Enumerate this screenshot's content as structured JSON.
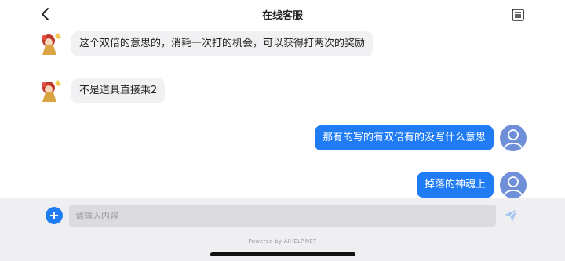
{
  "header": {
    "title": "在线客服",
    "back_icon": "chevron-left-icon",
    "menu_icon": "document-list-icon"
  },
  "messages": [
    {
      "from": "agent",
      "text": "这个双倍的意思的，消耗一次打的机会，可以获得打两次的奖励"
    },
    {
      "from": "agent",
      "text": "不是道具直接乘2"
    },
    {
      "from": "user",
      "text": "那有的写的有双倍有的没写什么意思"
    },
    {
      "from": "user",
      "text": "掉落的神魂上"
    }
  ],
  "composer": {
    "placeholder": "请输入内容",
    "add_icon": "plus-circle-icon",
    "send_icon": "send-icon",
    "powered_by": "Powered by AIHELP.NET"
  },
  "colors": {
    "accent": "#1f7cf5",
    "agent_bubble": "#f1f1f3",
    "composer_bg": "#efeff2",
    "user_avatar": "#6f8fd8"
  }
}
